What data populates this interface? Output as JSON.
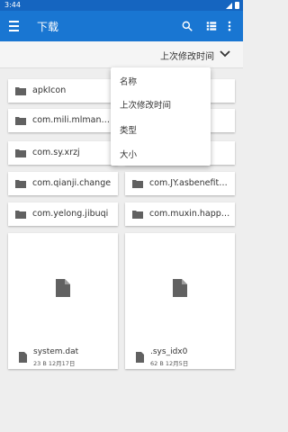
{
  "status": {
    "time": "3:44"
  },
  "appbar": {
    "title": "下载"
  },
  "sort": {
    "label": "上次修改时间"
  },
  "folders": [
    {
      "name": "apkIcon"
    },
    {
      "name": ""
    },
    {
      "name": "com.mili.mlmanager"
    },
    {
      "name": ""
    },
    {
      "name": "com.sy.xrzj"
    },
    {
      "name": ""
    },
    {
      "name": "com.qianji.change"
    },
    {
      "name": "com.JY.asbenefitwal..."
    },
    {
      "name": "com.yelong.jibuqi"
    },
    {
      "name": "com.muxin.happysp..."
    }
  ],
  "files": [
    {
      "name": "system.dat",
      "meta": "23 B 12月17日"
    },
    {
      "name": ".sys_idx0",
      "meta": "62 B 12月5日"
    }
  ],
  "dropdown": {
    "options": [
      "名称",
      "上次修改时间",
      "类型",
      "大小"
    ]
  },
  "colors": {
    "primary": "#1976d2",
    "statusbar": "#1565c0"
  }
}
